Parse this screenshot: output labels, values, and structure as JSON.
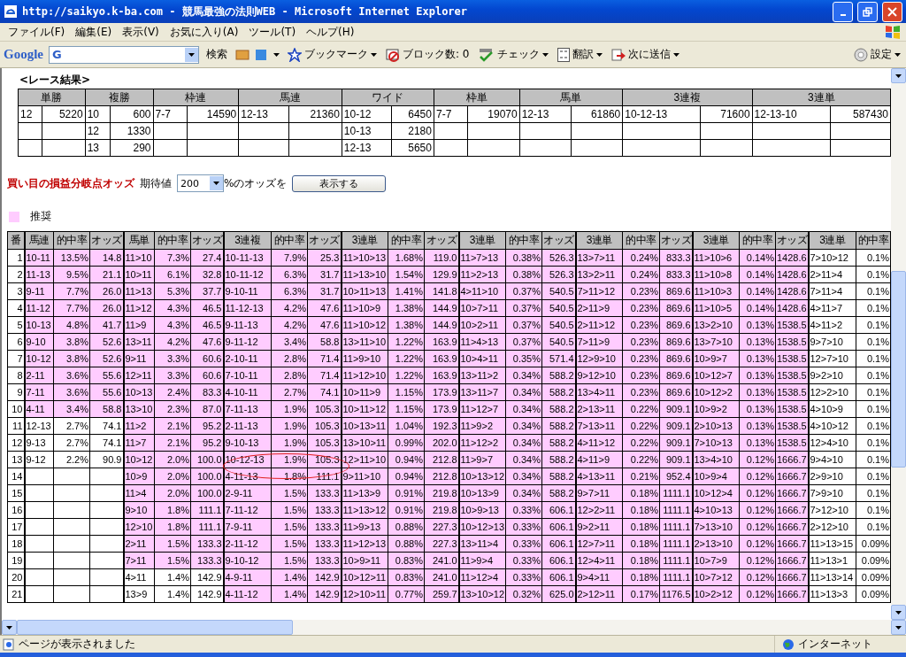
{
  "window": {
    "title": "http://saikyo.k-ba.com - 競馬最強の法則WEB - Microsoft Internet Explorer"
  },
  "menu": [
    "ファイル(F)",
    "編集(E)",
    "表示(V)",
    "お気に入り(A)",
    "ツール(T)",
    "ヘルプ(H)"
  ],
  "toolbar": {
    "logo": "Google",
    "search_value": "G",
    "items": [
      {
        "kind": "search",
        "label": "検索",
        "dropdown": false
      },
      {
        "kind": "bookmark",
        "label": "ブックマーク",
        "dropdown": true
      },
      {
        "kind": "block",
        "label": "ブロック数: 0",
        "dropdown": false
      },
      {
        "kind": "check",
        "label": "チェック",
        "dropdown": true
      },
      {
        "kind": "translate",
        "label": "翻訳",
        "dropdown": true
      },
      {
        "kind": "send",
        "label": "次に送信",
        "dropdown": true
      },
      {
        "kind": "settings",
        "label": "設定",
        "dropdown": true
      }
    ]
  },
  "results": {
    "title": "<レース結果>",
    "bets": [
      {
        "type": "単勝",
        "payouts": [
          {
            "combo": "12",
            "amount": "5220"
          }
        ]
      },
      {
        "type": "複勝",
        "payouts": [
          {
            "combo": "10",
            "amount": "600"
          },
          {
            "combo": "12",
            "amount": "1330"
          },
          {
            "combo": "13",
            "amount": "290"
          }
        ]
      },
      {
        "type": "枠連",
        "payouts": [
          {
            "combo": "7-7",
            "amount": "14590"
          }
        ]
      },
      {
        "type": "馬連",
        "payouts": [
          {
            "combo": "12-13",
            "amount": "21360"
          }
        ]
      },
      {
        "type": "ワイド",
        "payouts": [
          {
            "combo": "10-12",
            "amount": "6450"
          },
          {
            "combo": "10-13",
            "amount": "2180"
          },
          {
            "combo": "12-13",
            "amount": "5650"
          }
        ]
      },
      {
        "type": "枠単",
        "payouts": [
          {
            "combo": "7-7",
            "amount": "19070"
          }
        ]
      },
      {
        "type": "馬単",
        "payouts": [
          {
            "combo": "12-13",
            "amount": "61860"
          }
        ]
      },
      {
        "type": "3連複",
        "payouts": [
          {
            "combo": "10-12-13",
            "amount": "71600"
          }
        ]
      },
      {
        "type": "3連単",
        "payouts": [
          {
            "combo": "12-13-10",
            "amount": "587430"
          }
        ]
      }
    ]
  },
  "odds_form": {
    "heading": "買い目の損益分岐点オッズ",
    "label": "期待値",
    "select_value": "200",
    "suffix": "%のオッズを",
    "button": "表示する"
  },
  "legend": {
    "label": "推奨",
    "color": "#ffccff"
  },
  "odds_table": {
    "number_header": "番",
    "groups": [
      {
        "bet": "馬連",
        "rate": "的中率",
        "odds": "オッズ"
      },
      {
        "bet": "馬単",
        "rate": "的中率",
        "odds": "オッズ"
      },
      {
        "bet": "3連複",
        "rate": "的中率",
        "odds": "オッズ"
      },
      {
        "bet": "3連単",
        "rate": "的中率",
        "odds": "オッズ"
      },
      {
        "bet": "3連単",
        "rate": "的中率",
        "odds": "オッズ"
      },
      {
        "bet": "3連単",
        "rate": "的中率",
        "odds": "オッズ"
      },
      {
        "bet": "3連単",
        "rate": "的中率",
        "odds": "オッズ"
      },
      {
        "bet": "3連単",
        "rate": "的中率"
      }
    ],
    "rows": [
      {
        "no": "1",
        "bets": [
          {
            "combo": "10-11",
            "rate": "13.5%",
            "odds": "14.8",
            "recommended": true
          },
          {
            "combo": "11>10",
            "rate": "7.3%",
            "odds": "27.4",
            "recommended": true
          },
          {
            "combo": "10-11-13",
            "rate": "7.9%",
            "odds": "25.3",
            "recommended": true
          },
          {
            "combo": "11>10>13",
            "rate": "1.68%",
            "odds": "119.0",
            "recommended": true
          },
          {
            "combo": "11>7>13",
            "rate": "0.38%",
            "odds": "526.3",
            "recommended": true
          },
          {
            "combo": "13>7>11",
            "rate": "0.24%",
            "odds": "833.3",
            "recommended": true
          },
          {
            "combo": "11>10>6",
            "rate": "0.14%",
            "odds": "1428.6",
            "recommended": true
          },
          {
            "combo": "7>10>12",
            "rate": "0.1%",
            "recommended": false
          }
        ]
      },
      {
        "no": "2",
        "bets": [
          {
            "combo": "11-13",
            "rate": "9.5%",
            "odds": "21.1",
            "recommended": true
          },
          {
            "combo": "10>11",
            "rate": "6.1%",
            "odds": "32.8",
            "recommended": true
          },
          {
            "combo": "10-11-12",
            "rate": "6.3%",
            "odds": "31.7",
            "recommended": true
          },
          {
            "combo": "11>13>10",
            "rate": "1.54%",
            "odds": "129.9",
            "recommended": true
          },
          {
            "combo": "11>2>13",
            "rate": "0.38%",
            "odds": "526.3",
            "recommended": true
          },
          {
            "combo": "13>2>11",
            "rate": "0.24%",
            "odds": "833.3",
            "recommended": true
          },
          {
            "combo": "11>10>8",
            "rate": "0.14%",
            "odds": "1428.6",
            "recommended": true
          },
          {
            "combo": "2>11>4",
            "rate": "0.1%",
            "recommended": false
          }
        ]
      },
      {
        "no": "3",
        "bets": [
          {
            "combo": "9-11",
            "rate": "7.7%",
            "odds": "26.0",
            "recommended": true
          },
          {
            "combo": "11>13",
            "rate": "5.3%",
            "odds": "37.7",
            "recommended": true
          },
          {
            "combo": "9-10-11",
            "rate": "6.3%",
            "odds": "31.7",
            "recommended": true
          },
          {
            "combo": "10>11>13",
            "rate": "1.41%",
            "odds": "141.8",
            "recommended": true
          },
          {
            "combo": "4>11>10",
            "rate": "0.37%",
            "odds": "540.5",
            "recommended": true
          },
          {
            "combo": "7>11>12",
            "rate": "0.23%",
            "odds": "869.6",
            "recommended": true
          },
          {
            "combo": "11>10>3",
            "rate": "0.14%",
            "odds": "1428.6",
            "recommended": true
          },
          {
            "combo": "7>11>4",
            "rate": "0.1%",
            "recommended": false
          }
        ]
      },
      {
        "no": "4",
        "bets": [
          {
            "combo": "11-12",
            "rate": "7.7%",
            "odds": "26.0",
            "recommended": true
          },
          {
            "combo": "11>12",
            "rate": "4.3%",
            "odds": "46.5",
            "recommended": true
          },
          {
            "combo": "11-12-13",
            "rate": "4.2%",
            "odds": "47.6",
            "recommended": true
          },
          {
            "combo": "11>10>9",
            "rate": "1.38%",
            "odds": "144.9",
            "recommended": true
          },
          {
            "combo": "10>7>11",
            "rate": "0.37%",
            "odds": "540.5",
            "recommended": true
          },
          {
            "combo": "2>11>9",
            "rate": "0.23%",
            "odds": "869.6",
            "recommended": true
          },
          {
            "combo": "11>10>5",
            "rate": "0.14%",
            "odds": "1428.6",
            "recommended": true
          },
          {
            "combo": "4>11>7",
            "rate": "0.1%",
            "recommended": false
          }
        ]
      },
      {
        "no": "5",
        "bets": [
          {
            "combo": "10-13",
            "rate": "4.8%",
            "odds": "41.7",
            "recommended": true
          },
          {
            "combo": "11>9",
            "rate": "4.3%",
            "odds": "46.5",
            "recommended": true
          },
          {
            "combo": "9-11-13",
            "rate": "4.2%",
            "odds": "47.6",
            "recommended": true
          },
          {
            "combo": "11>10>12",
            "rate": "1.38%",
            "odds": "144.9",
            "recommended": true
          },
          {
            "combo": "10>2>11",
            "rate": "0.37%",
            "odds": "540.5",
            "recommended": true
          },
          {
            "combo": "2>11>12",
            "rate": "0.23%",
            "odds": "869.6",
            "recommended": true
          },
          {
            "combo": "13>2>10",
            "rate": "0.13%",
            "odds": "1538.5",
            "recommended": true
          },
          {
            "combo": "4>11>2",
            "rate": "0.1%",
            "recommended": false
          }
        ]
      },
      {
        "no": "6",
        "bets": [
          {
            "combo": "9-10",
            "rate": "3.8%",
            "odds": "52.6",
            "recommended": true
          },
          {
            "combo": "13>11",
            "rate": "4.2%",
            "odds": "47.6",
            "recommended": true
          },
          {
            "combo": "9-11-12",
            "rate": "3.4%",
            "odds": "58.8",
            "recommended": true
          },
          {
            "combo": "13>11>10",
            "rate": "1.22%",
            "odds": "163.9",
            "recommended": true
          },
          {
            "combo": "11>4>13",
            "rate": "0.37%",
            "odds": "540.5",
            "recommended": true
          },
          {
            "combo": "7>11>9",
            "rate": "0.23%",
            "odds": "869.6",
            "recommended": true
          },
          {
            "combo": "13>7>10",
            "rate": "0.13%",
            "odds": "1538.5",
            "recommended": true
          },
          {
            "combo": "9>7>10",
            "rate": "0.1%",
            "recommended": false
          }
        ]
      },
      {
        "no": "7",
        "bets": [
          {
            "combo": "10-12",
            "rate": "3.8%",
            "odds": "52.6",
            "recommended": true
          },
          {
            "combo": "9>11",
            "rate": "3.3%",
            "odds": "60.6",
            "recommended": true
          },
          {
            "combo": "2-10-11",
            "rate": "2.8%",
            "odds": "71.4",
            "recommended": true
          },
          {
            "combo": "11>9>10",
            "rate": "1.22%",
            "odds": "163.9",
            "recommended": true
          },
          {
            "combo": "10>4>11",
            "rate": "0.35%",
            "odds": "571.4",
            "recommended": true
          },
          {
            "combo": "12>9>10",
            "rate": "0.23%",
            "odds": "869.6",
            "recommended": true
          },
          {
            "combo": "10>9>7",
            "rate": "0.13%",
            "odds": "1538.5",
            "recommended": true
          },
          {
            "combo": "12>7>10",
            "rate": "0.1%",
            "recommended": false
          }
        ]
      },
      {
        "no": "8",
        "bets": [
          {
            "combo": "2-11",
            "rate": "3.6%",
            "odds": "55.6",
            "recommended": true
          },
          {
            "combo": "12>11",
            "rate": "3.3%",
            "odds": "60.6",
            "recommended": true
          },
          {
            "combo": "7-10-11",
            "rate": "2.8%",
            "odds": "71.4",
            "recommended": true
          },
          {
            "combo": "11>12>10",
            "rate": "1.22%",
            "odds": "163.9",
            "recommended": true
          },
          {
            "combo": "13>11>2",
            "rate": "0.34%",
            "odds": "588.2",
            "recommended": true
          },
          {
            "combo": "9>12>10",
            "rate": "0.23%",
            "odds": "869.6",
            "recommended": true
          },
          {
            "combo": "10>12>7",
            "rate": "0.13%",
            "odds": "1538.5",
            "recommended": true
          },
          {
            "combo": "9>2>10",
            "rate": "0.1%",
            "recommended": false
          }
        ]
      },
      {
        "no": "9",
        "bets": [
          {
            "combo": "7-11",
            "rate": "3.6%",
            "odds": "55.6",
            "recommended": true
          },
          {
            "combo": "10>13",
            "rate": "2.4%",
            "odds": "83.3",
            "recommended": true
          },
          {
            "combo": "4-10-11",
            "rate": "2.7%",
            "odds": "74.1",
            "recommended": true
          },
          {
            "combo": "10>11>9",
            "rate": "1.15%",
            "odds": "173.9",
            "recommended": true
          },
          {
            "combo": "13>11>7",
            "rate": "0.34%",
            "odds": "588.2",
            "recommended": true
          },
          {
            "combo": "13>4>11",
            "rate": "0.23%",
            "odds": "869.6",
            "recommended": true
          },
          {
            "combo": "10>12>2",
            "rate": "0.13%",
            "odds": "1538.5",
            "recommended": true
          },
          {
            "combo": "12>2>10",
            "rate": "0.1%",
            "recommended": false
          }
        ]
      },
      {
        "no": "10",
        "bets": [
          {
            "combo": "4-11",
            "rate": "3.4%",
            "odds": "58.8",
            "recommended": true
          },
          {
            "combo": "13>10",
            "rate": "2.3%",
            "odds": "87.0",
            "recommended": true
          },
          {
            "combo": "7-11-13",
            "rate": "1.9%",
            "odds": "105.3",
            "recommended": true
          },
          {
            "combo": "10>11>12",
            "rate": "1.15%",
            "odds": "173.9",
            "recommended": true
          },
          {
            "combo": "11>12>7",
            "rate": "0.34%",
            "odds": "588.2",
            "recommended": true
          },
          {
            "combo": "2>13>11",
            "rate": "0.22%",
            "odds": "909.1",
            "recommended": true
          },
          {
            "combo": "10>9>2",
            "rate": "0.13%",
            "odds": "1538.5",
            "recommended": true
          },
          {
            "combo": "4>10>9",
            "rate": "0.1%",
            "recommended": false
          }
        ]
      },
      {
        "no": "11",
        "bets": [
          {
            "combo": "12-13",
            "rate": "2.7%",
            "odds": "74.1",
            "recommended": false
          },
          {
            "combo": "11>2",
            "rate": "2.1%",
            "odds": "95.2",
            "recommended": true
          },
          {
            "combo": "2-11-13",
            "rate": "1.9%",
            "odds": "105.3",
            "recommended": true
          },
          {
            "combo": "10>13>11",
            "rate": "1.04%",
            "odds": "192.3",
            "recommended": true
          },
          {
            "combo": "11>9>2",
            "rate": "0.34%",
            "odds": "588.2",
            "recommended": true
          },
          {
            "combo": "7>13>11",
            "rate": "0.22%",
            "odds": "909.1",
            "recommended": true
          },
          {
            "combo": "2>10>13",
            "rate": "0.13%",
            "odds": "1538.5",
            "recommended": true
          },
          {
            "combo": "4>10>12",
            "rate": "0.1%",
            "recommended": false
          }
        ]
      },
      {
        "no": "12",
        "bets": [
          {
            "combo": "9-13",
            "rate": "2.7%",
            "odds": "74.1",
            "recommended": false
          },
          {
            "combo": "11>7",
            "rate": "2.1%",
            "odds": "95.2",
            "recommended": true
          },
          {
            "combo": "9-10-13",
            "rate": "1.9%",
            "odds": "105.3",
            "recommended": true
          },
          {
            "combo": "13>10>11",
            "rate": "0.99%",
            "odds": "202.0",
            "recommended": true
          },
          {
            "combo": "11>12>2",
            "rate": "0.34%",
            "odds": "588.2",
            "recommended": true
          },
          {
            "combo": "4>11>12",
            "rate": "0.22%",
            "odds": "909.1",
            "recommended": true
          },
          {
            "combo": "7>10>13",
            "rate": "0.13%",
            "odds": "1538.5",
            "recommended": true
          },
          {
            "combo": "12>4>10",
            "rate": "0.1%",
            "recommended": false
          }
        ]
      },
      {
        "no": "13",
        "bets": [
          {
            "combo": "9-12",
            "rate": "2.2%",
            "odds": "90.9",
            "recommended": false
          },
          {
            "combo": "10>12",
            "rate": "2.0%",
            "odds": "100.0",
            "recommended": true
          },
          {
            "combo": "10-12-13",
            "rate": "1.9%",
            "odds": "105.3",
            "recommended": true,
            "circled": true
          },
          {
            "combo": "12>11>10",
            "rate": "0.94%",
            "odds": "212.8",
            "recommended": true
          },
          {
            "combo": "11>9>7",
            "rate": "0.34%",
            "odds": "588.2",
            "recommended": true
          },
          {
            "combo": "4>11>9",
            "rate": "0.22%",
            "odds": "909.1",
            "recommended": true
          },
          {
            "combo": "13>4>10",
            "rate": "0.12%",
            "odds": "1666.7",
            "recommended": true
          },
          {
            "combo": "9>4>10",
            "rate": "0.1%",
            "recommended": false
          }
        ]
      },
      {
        "no": "14",
        "bets": [
          {
            "combo": "10>9",
            "rate": "2.0%",
            "odds": "100.0",
            "recommended": true
          },
          {
            "combo": "4-11-13",
            "rate": "1.8%",
            "odds": "111.1",
            "recommended": true
          },
          {
            "combo": "9>11>10",
            "rate": "0.94%",
            "odds": "212.8",
            "recommended": true
          },
          {
            "combo": "10>13>12",
            "rate": "0.34%",
            "odds": "588.2",
            "recommended": true
          },
          {
            "combo": "4>13>11",
            "rate": "0.21%",
            "odds": "952.4",
            "recommended": true
          },
          {
            "combo": "10>9>4",
            "rate": "0.12%",
            "odds": "1666.7",
            "recommended": true
          },
          {
            "combo": "2>9>10",
            "rate": "0.1%",
            "recommended": false
          }
        ]
      },
      {
        "no": "15",
        "bets": [
          {
            "combo": "11>4",
            "rate": "2.0%",
            "odds": "100.0",
            "recommended": true
          },
          {
            "combo": "2-9-11",
            "rate": "1.5%",
            "odds": "133.3",
            "recommended": true
          },
          {
            "combo": "11>13>9",
            "rate": "0.91%",
            "odds": "219.8",
            "recommended": true
          },
          {
            "combo": "10>13>9",
            "rate": "0.34%",
            "odds": "588.2",
            "recommended": true
          },
          {
            "combo": "9>7>11",
            "rate": "0.18%",
            "odds": "1111.1",
            "recommended": true
          },
          {
            "combo": "10>12>4",
            "rate": "0.12%",
            "odds": "1666.7",
            "recommended": true
          },
          {
            "combo": "7>9>10",
            "rate": "0.1%",
            "recommended": false
          }
        ]
      },
      {
        "no": "16",
        "bets": [
          {
            "combo": "9>10",
            "rate": "1.8%",
            "odds": "111.1",
            "recommended": true
          },
          {
            "combo": "7-11-12",
            "rate": "1.5%",
            "odds": "133.3",
            "recommended": true
          },
          {
            "combo": "11>13>12",
            "rate": "0.91%",
            "odds": "219.8",
            "recommended": true
          },
          {
            "combo": "10>9>13",
            "rate": "0.33%",
            "odds": "606.1",
            "recommended": true
          },
          {
            "combo": "12>2>11",
            "rate": "0.18%",
            "odds": "1111.1",
            "recommended": true
          },
          {
            "combo": "4>10>13",
            "rate": "0.12%",
            "odds": "1666.7",
            "recommended": true
          },
          {
            "combo": "7>12>10",
            "rate": "0.1%",
            "recommended": false
          }
        ]
      },
      {
        "no": "17",
        "bets": [
          {
            "combo": "12>10",
            "rate": "1.8%",
            "odds": "111.1",
            "recommended": true
          },
          {
            "combo": "7-9-11",
            "rate": "1.5%",
            "odds": "133.3",
            "recommended": true
          },
          {
            "combo": "11>9>13",
            "rate": "0.88%",
            "odds": "227.3",
            "recommended": true
          },
          {
            "combo": "10>12>13",
            "rate": "0.33%",
            "odds": "606.1",
            "recommended": true
          },
          {
            "combo": "9>2>11",
            "rate": "0.18%",
            "odds": "1111.1",
            "recommended": true
          },
          {
            "combo": "7>13>10",
            "rate": "0.12%",
            "odds": "1666.7",
            "recommended": true
          },
          {
            "combo": "2>12>10",
            "rate": "0.1%",
            "recommended": false
          }
        ]
      },
      {
        "no": "18",
        "bets": [
          {
            "combo": "2>11",
            "rate": "1.5%",
            "odds": "133.3",
            "recommended": true
          },
          {
            "combo": "2-11-12",
            "rate": "1.5%",
            "odds": "133.3",
            "recommended": true
          },
          {
            "combo": "11>12>13",
            "rate": "0.88%",
            "odds": "227.3",
            "recommended": true
          },
          {
            "combo": "13>11>4",
            "rate": "0.33%",
            "odds": "606.1",
            "recommended": true
          },
          {
            "combo": "12>7>11",
            "rate": "0.18%",
            "odds": "1111.1",
            "recommended": true
          },
          {
            "combo": "2>13>10",
            "rate": "0.12%",
            "odds": "1666.7",
            "recommended": true
          },
          {
            "combo": "11>13>15",
            "rate": "0.09%",
            "recommended": false
          }
        ]
      },
      {
        "no": "19",
        "bets": [
          {
            "combo": "7>11",
            "rate": "1.5%",
            "odds": "133.3",
            "recommended": true
          },
          {
            "combo": "9-10-12",
            "rate": "1.5%",
            "odds": "133.3",
            "recommended": true
          },
          {
            "combo": "10>9>11",
            "rate": "0.83%",
            "odds": "241.0",
            "recommended": true
          },
          {
            "combo": "11>9>4",
            "rate": "0.33%",
            "odds": "606.1",
            "recommended": true
          },
          {
            "combo": "12>4>11",
            "rate": "0.18%",
            "odds": "1111.1",
            "recommended": true
          },
          {
            "combo": "10>7>9",
            "rate": "0.12%",
            "odds": "1666.7",
            "recommended": true
          },
          {
            "combo": "11>13>1",
            "rate": "0.09%",
            "recommended": false
          }
        ]
      },
      {
        "no": "20",
        "bets": [
          {
            "combo": "4>11",
            "rate": "1.4%",
            "odds": "142.9",
            "recommended": false
          },
          {
            "combo": "4-9-11",
            "rate": "1.4%",
            "odds": "142.9",
            "recommended": true
          },
          {
            "combo": "10>12>11",
            "rate": "0.83%",
            "odds": "241.0",
            "recommended": true
          },
          {
            "combo": "11>12>4",
            "rate": "0.33%",
            "odds": "606.1",
            "recommended": true
          },
          {
            "combo": "9>4>11",
            "rate": "0.18%",
            "odds": "1111.1",
            "recommended": true
          },
          {
            "combo": "10>7>12",
            "rate": "0.12%",
            "odds": "1666.7",
            "recommended": true
          },
          {
            "combo": "11>13>14",
            "rate": "0.09%",
            "recommended": false
          }
        ]
      },
      {
        "no": "21",
        "bets": [
          {
            "combo": "13>9",
            "rate": "1.4%",
            "odds": "142.9",
            "recommended": false
          },
          {
            "combo": "4-11-12",
            "rate": "1.4%",
            "odds": "142.9",
            "recommended": true
          },
          {
            "combo": "12>10>11",
            "rate": "0.77%",
            "odds": "259.7",
            "recommended": true
          },
          {
            "combo": "13>10>12",
            "rate": "0.32%",
            "odds": "625.0",
            "recommended": true
          },
          {
            "combo": "2>12>11",
            "rate": "0.17%",
            "odds": "1176.5",
            "recommended": true
          },
          {
            "combo": "10>2>12",
            "rate": "0.12%",
            "odds": "1666.7",
            "recommended": true
          },
          {
            "combo": "11>13>3",
            "rate": "0.09%",
            "recommended": false
          }
        ]
      }
    ]
  },
  "status_bar": {
    "message": "ページが表示されました",
    "zone": "インターネット"
  }
}
